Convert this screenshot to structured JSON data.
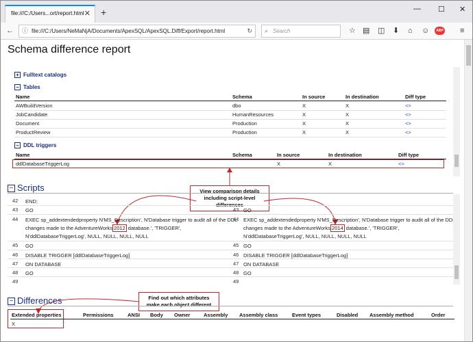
{
  "browser": {
    "tab_title": "file:///C:/Users...ort/report.html",
    "tab_close": "✕",
    "new_tab": "+",
    "minimize": "—",
    "maximize": "☐",
    "close": "✕",
    "url": "file:///C:/Users/NeMaNjA/Documents/ApexSQL/ApexSQL.Diff/Export/report.html",
    "search_placeholder": "Search",
    "adblock_badge": "ABP"
  },
  "report": {
    "title": "Schema difference report",
    "fulltext": {
      "toggle": "+",
      "label": "Fulltext catalogs"
    },
    "tables": {
      "toggle": "−",
      "label": "Tables",
      "headers": [
        "Name",
        "Schema",
        "In source",
        "In destination",
        "Diff type"
      ],
      "rows": [
        [
          "AWBuildVersion",
          "dbo",
          "X",
          "X",
          "<>"
        ],
        [
          "JobCandidate",
          "HumanResources",
          "X",
          "X",
          "<>"
        ],
        [
          "Document",
          "Production",
          "X",
          "X",
          "<>"
        ],
        [
          "ProductReview",
          "Production",
          "X",
          "X",
          "<>"
        ]
      ]
    },
    "ddl": {
      "toggle": "−",
      "label": "DDL triggers",
      "headers": [
        "Name",
        "Schema",
        "In source",
        "In destination",
        "Diff type"
      ],
      "rows": [
        [
          "ddlDatabaseTriggerLog",
          "",
          "X",
          "X",
          "<>"
        ]
      ]
    },
    "scripts": {
      "toggle": "−",
      "label": "Scripts",
      "left": {
        "l42": "42",
        "c42": "END;",
        "l43": "43",
        "c43": "GO",
        "l44": "44",
        "c44a": "EXEC sp_addextendedproperty N'MS_Description', N'Database trigger to audit all of the DDL",
        "c44b_pre": "changes made to the AdventureWorks",
        "c44b_hl": "2012",
        "c44b_post": " database.', 'TRIGGER',",
        "c44c": "N'ddlDatabaseTriggerLog', NULL, NULL, NULL, NULL",
        "l45": "45",
        "c45": "GO",
        "l46": "46",
        "c46": "DISABLE TRIGGER [ddlDatabaseTriggerLog]",
        "l47": "47",
        "c47": "ON DATABASE",
        "l48": "48",
        "c48": "GO",
        "l49": "49"
      },
      "right": {
        "l43": "43",
        "c43": "GO",
        "l44": "44",
        "c44a": "EXEC sp_addextendedproperty N'MS_Description', N'Database trigger to audit all of the DDL",
        "c44b_pre": "changes made to the AdventureWorks",
        "c44b_hl": "2014",
        "c44b_post": " database.', 'TRIGGER',",
        "c44c": "N'ddlDatabaseTriggerLog', NULL, NULL, NULL, NULL",
        "l45": "45",
        "c45": "GO",
        "l46": "46",
        "c46": "DISABLE TRIGGER [ddlDatabaseTriggerLog]",
        "l47": "47",
        "c47": "ON DATABASE",
        "l48": "48",
        "c48": "GO",
        "l49": "49"
      }
    },
    "differences": {
      "toggle": "−",
      "label": "Differences",
      "headers": [
        "Extended properties",
        "Permissions",
        "ANSI",
        "Body",
        "Owner",
        "Assembly",
        "Assembly class",
        "Event types",
        "Disabled",
        "Assembly method",
        "Order"
      ],
      "row": [
        "X"
      ]
    },
    "callouts": {
      "script_diff": "View comparison details including script-level differences",
      "attributes": "Find out which attributes make each object different"
    }
  },
  "colors": {
    "accent": "#0a84ff",
    "callout_border": "#c0272d",
    "section_title": "#1a2f7a"
  }
}
